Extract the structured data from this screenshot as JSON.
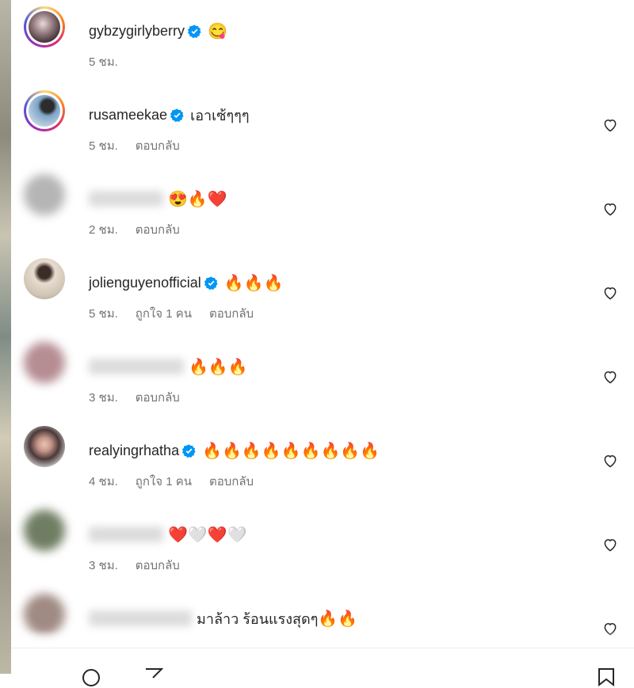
{
  "comments": [
    {
      "username": "gybzygirlyberry",
      "verified": true,
      "text": "",
      "emoji": "😋",
      "time": "5 ชม.",
      "likes": "",
      "reply": "",
      "story": true,
      "blur": false,
      "heart": false,
      "avatar_color": "#6b5e63"
    },
    {
      "username": "rusameekae",
      "verified": true,
      "text": "เอาเซ้ๆๆๆ",
      "emoji": "",
      "time": "5 ชม.",
      "likes": "",
      "reply": "ตอบกลับ",
      "story": true,
      "blur": false,
      "heart": true,
      "avatar_color": "#4d6a8a"
    },
    {
      "username": "",
      "verified": false,
      "text": "",
      "emoji": "😍🔥❤️",
      "time": "2 ชม.",
      "likes": "",
      "reply": "ตอบกลับ",
      "story": false,
      "blur": true,
      "heart": true,
      "avatar_color": "#a8a8a8"
    },
    {
      "username": "jolienguyenofficial",
      "verified": true,
      "text": "",
      "emoji": "🔥🔥🔥",
      "time": "5 ชม.",
      "likes": "ถูกใจ 1 คน",
      "reply": "ตอบกลับ",
      "story": false,
      "blur": false,
      "heart": true,
      "avatar_color": "#b9ab9b"
    },
    {
      "username": "",
      "verified": false,
      "text": "",
      "emoji": "🔥🔥🔥",
      "time": "3 ชม.",
      "likes": "",
      "reply": "ตอบกลับ",
      "story": false,
      "blur": true,
      "heart": true,
      "avatar_color": "#b08a8f"
    },
    {
      "username": "realyingrhatha",
      "verified": true,
      "text": "",
      "emoji": "🔥🔥🔥🔥🔥🔥🔥🔥🔥",
      "time": "4 ชม.",
      "likes": "ถูกใจ 1 คน",
      "reply": "ตอบกลับ",
      "story": false,
      "blur": false,
      "heart": true,
      "avatar_color": "#5a4b49"
    },
    {
      "username": "",
      "verified": false,
      "text": "",
      "emoji": "❤️🤍❤️🤍",
      "time": "3 ชม.",
      "likes": "",
      "reply": "ตอบกลับ",
      "story": false,
      "blur": true,
      "heart": true,
      "avatar_color": "#6f7d62"
    },
    {
      "username": "",
      "verified": false,
      "text": "มาล้าว ร้อนแรงสุดๆ",
      "emoji": "🔥🔥",
      "time": "",
      "likes": "",
      "reply": "",
      "story": false,
      "blur": true,
      "heart": true,
      "avatar_color": "#a08a83"
    }
  ],
  "colors": {
    "verified": "#0095f6",
    "secondary_text": "#737373",
    "fire": "#ff6a13"
  }
}
